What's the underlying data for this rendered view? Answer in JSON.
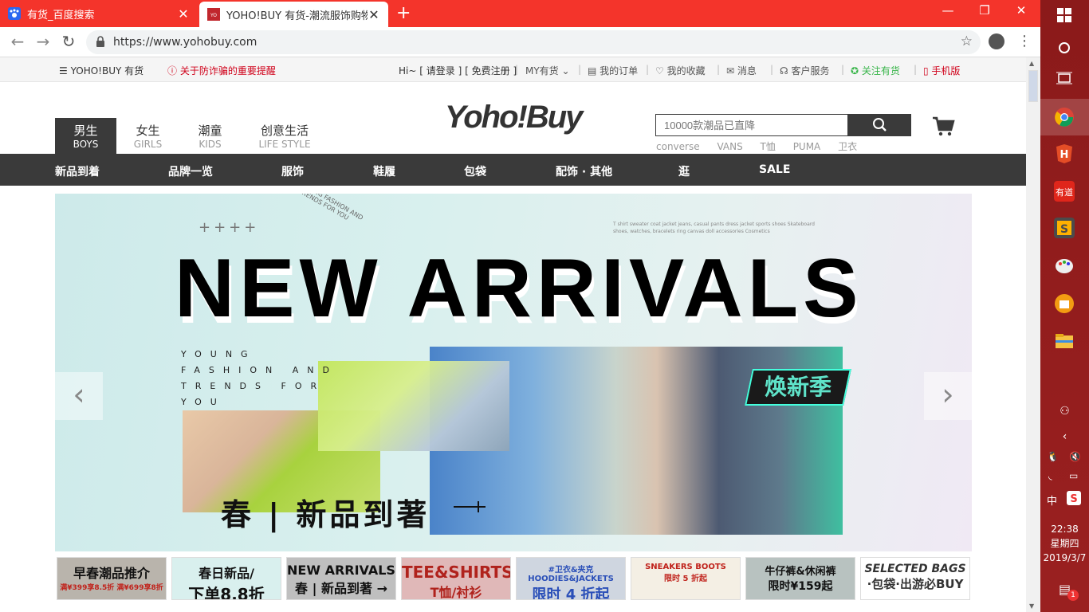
{
  "browser": {
    "tabs": [
      {
        "title": "有货_百度搜索",
        "favicon": "baidu-paw-icon",
        "active": false
      },
      {
        "title": "YOHO!BUY 有货-潮流服饰购物网",
        "favicon": "yoho-icon",
        "active": true
      }
    ],
    "url": "https://www.yohobuy.com",
    "colors": {
      "tabstrip": "#f4342b"
    }
  },
  "topbar": {
    "menu_label": "YOHO!BUY 有货",
    "alert": "关于防诈骗的重要提醒",
    "greeting": "Hi~ [",
    "login": "请登录",
    "mid": "] [",
    "register": "免费注册",
    "end": "]",
    "my_yoho": "MY有货",
    "orders": "我的订单",
    "favorites": "我的收藏",
    "messages": "消息",
    "service": "客户服务",
    "follow": "关注有货",
    "mobile": "手机版"
  },
  "header": {
    "gender_tabs": [
      {
        "cn": "男生",
        "en": "BOYS",
        "active": true
      },
      {
        "cn": "女生",
        "en": "GIRLS",
        "active": false
      },
      {
        "cn": "潮童",
        "en": "KIDS",
        "active": false
      },
      {
        "cn": "创意生活",
        "en": "LIFE STYLE",
        "active": false
      }
    ],
    "logo": "Yoho!Buy",
    "search_placeholder": "10000款潮品已直降",
    "hot_words": [
      "converse",
      "VANS",
      "T恤",
      "PUMA",
      "卫衣"
    ]
  },
  "mainnav": [
    "新品到着",
    "品牌一览",
    "服饰",
    "鞋履",
    "包袋",
    "配饰 · 其他",
    "逛",
    "SALE"
  ],
  "banner": {
    "plus": "++++",
    "circle_text": "YOUNG FASHION AND TRENDS FOR YOU",
    "small_text": "T shirt sweater coat jacket jeans, casual pants dress jacket sports shoes Skateboard shoes, watches, bracelets ring canvas doll accessories Cosmetics",
    "headline": "NEW ARRIVALS",
    "tagline": "YOUNG FASHION AND TRENDS FOR YOU",
    "sticker": "焕新季",
    "subline": "春 | 新品到著"
  },
  "thumbnails": [
    {
      "l1": "早春潮品推介",
      "l2": "满¥399享8.5折 满¥699享8折",
      "bg": "#cfd8e8",
      "color": "#1a2f6a"
    },
    {
      "l1": "春日新品/",
      "l2": "下单8.8折",
      "bg": "#b9b4ac",
      "color": "#111"
    },
    {
      "l1": "NEW ARRIVALS",
      "l2": "春 | 新品到著 →",
      "bg": "#d9f0ee",
      "color": "#111"
    },
    {
      "l1": "TEE&SHIRTS",
      "l2": "T恤/衬衫",
      "bg": "#bfbfbf",
      "color": "#111"
    },
    {
      "l1": "#卫衣&夹克 HOODIES&JACKETS",
      "l2": "限时 4 折起",
      "bg": "#e0b8b8",
      "color": "#b0221c"
    },
    {
      "l1": "SNEAKERS BOOTS",
      "l2": "限时 5 折起",
      "bg": "#cfd6e0",
      "color": "#2a4fb8"
    },
    {
      "l1": "牛仔裤&休闲裤",
      "l2": "限时¥159起",
      "bg": "#f4efe4",
      "color": "#c0231c"
    },
    {
      "l1": "SELECTED BAGS",
      "l2": "·包袋·出游必BUY",
      "bg": "#b8c2c0",
      "color": "#111"
    }
  ],
  "taskbar": {
    "time": "22:38",
    "weekday": "星期四",
    "date": "2019/3/7",
    "ime": "中",
    "notif_count": "1"
  }
}
